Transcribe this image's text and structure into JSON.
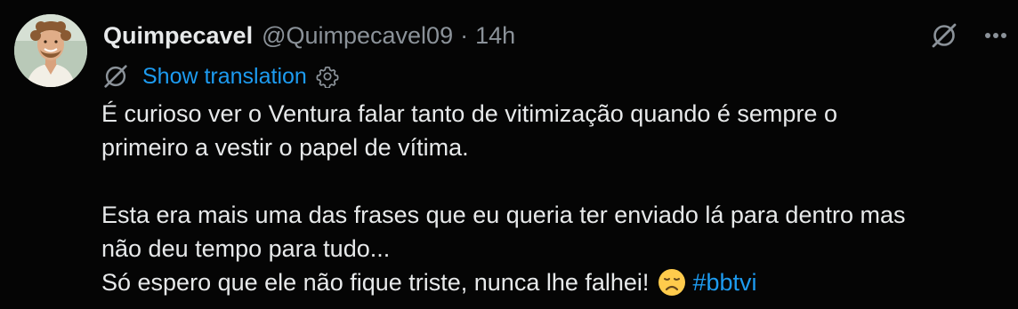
{
  "post": {
    "author": {
      "display_name": "Quimpecavel",
      "handle": "@Quimpecavel09",
      "separator": "·",
      "time": "14h",
      "avatar_icon": "user-avatar"
    },
    "top_actions": [
      "grok-icon",
      "more-icon"
    ],
    "translation": {
      "icon": "grok-icon",
      "label": "Show translation",
      "settings_icon": "gear-icon"
    },
    "body": {
      "paragraph1": [
        "É curioso ver o Ventura falar tanto de vitimização quando é sempre o",
        "primeiro a vestir o papel de vítima."
      ],
      "paragraph2": [
        "Esta era mais uma das frases que eu queria ter enviado lá para dentro mas",
        "não deu tempo para tudo..."
      ],
      "last_line_text": "Só espero que ele não fique triste, nunca lhe falhei! ",
      "emoji": "disappointed-face",
      "hashtag": "#bbtvi"
    }
  },
  "colors": {
    "background": "#050505",
    "text": "#e7e9ea",
    "secondary": "#8b9299",
    "link": "#1d9bf0"
  }
}
